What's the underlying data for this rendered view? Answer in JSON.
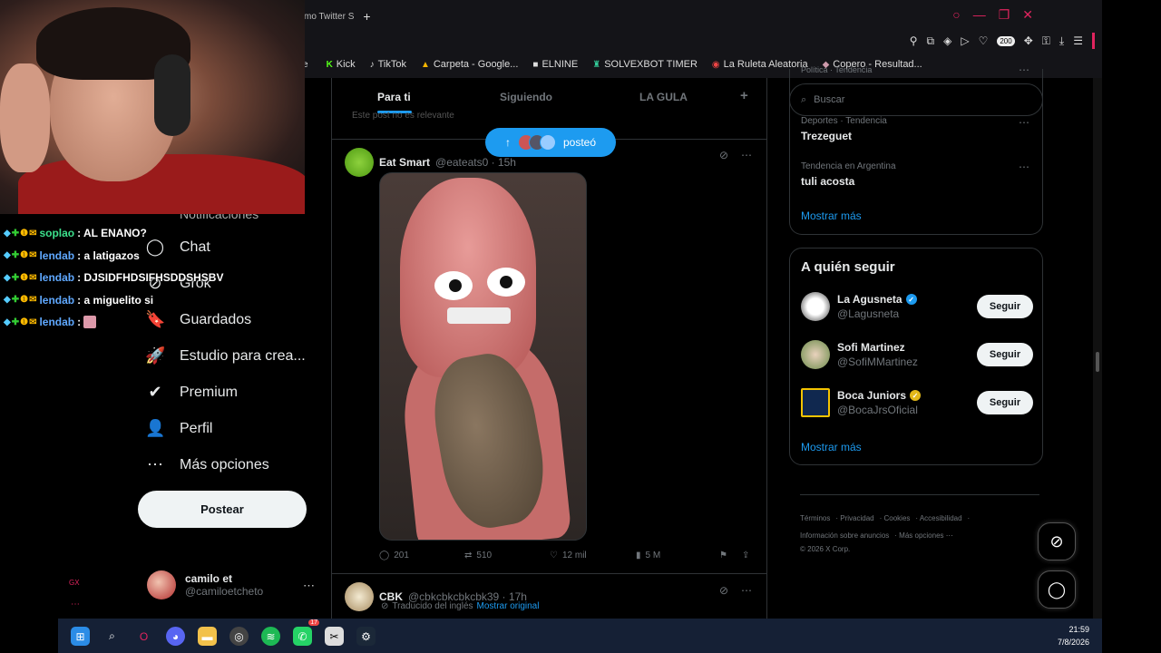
{
  "browser": {
    "tab_title": "itmo Twitter S",
    "new_tab": "+",
    "window_controls": [
      "○",
      "—",
      "❐",
      "✕"
    ],
    "extension_badge": "200",
    "bookmarks": [
      {
        "icon": "e",
        "label": ""
      },
      {
        "icon": "K",
        "label": "Kick"
      },
      {
        "icon": "♪",
        "label": "TikTok"
      },
      {
        "icon": "▲",
        "label": "Carpeta - Google..."
      },
      {
        "icon": "■",
        "label": "ELNINE"
      },
      {
        "icon": "♜",
        "label": "SOLVEXBOT TIMER"
      },
      {
        "icon": "◉",
        "label": "La Ruleta Aleatoria"
      },
      {
        "icon": "◆",
        "label": "Copero - Resultad..."
      }
    ]
  },
  "nav": {
    "partial_label": "Notificaciones",
    "items": [
      {
        "icon": "◯",
        "label": "Chat"
      },
      {
        "icon": "⊘",
        "label": "Grok"
      },
      {
        "icon": "🔖",
        "label": "Guardados"
      },
      {
        "icon": "🚀",
        "label": "Estudio para crea..."
      },
      {
        "icon": "✔",
        "label": "Premium"
      },
      {
        "icon": "👤",
        "label": "Perfil"
      },
      {
        "icon": "⋯",
        "label": "Más opciones"
      }
    ],
    "post_button": "Postear",
    "account": {
      "name": "camilo et",
      "handle": "@camiloetcheto",
      "more": "⋯"
    },
    "gx": "GX",
    "gx_dots": "⋯"
  },
  "stream_chat": [
    {
      "user": "soplao",
      "color": "green",
      "message": ": AL ENANO?"
    },
    {
      "user": "lendab",
      "color": "blue",
      "message": ": a latigazos"
    },
    {
      "user": "lendab",
      "color": "blue",
      "message": ": DJSIDFHDSIFHSDDSHSBV"
    },
    {
      "user": "lendab",
      "color": "blue",
      "message": ": a miguelito si"
    },
    {
      "user": "lendab",
      "color": "blue",
      "message": ":"
    }
  ],
  "timeline": {
    "tabs": [
      "Para ti",
      "Siguiendo",
      "LA GULA"
    ],
    "add_tab": "+",
    "hidden_note": "Este post no es relevante",
    "new_posts_label": "posteó",
    "tweet1": {
      "display_name": "Eat Smart",
      "handle": "@eateats0 · 15h",
      "replies": "201",
      "reposts": "510",
      "likes": "12 mil",
      "views": "5 M"
    },
    "tweet2": {
      "display_name": "CBK",
      "handle": "@cbkcbkcbkcbk39 · 17h",
      "translated": "Traducido del inglés",
      "show_original": "Mostrar original"
    }
  },
  "sidebar": {
    "search_placeholder": "Buscar",
    "trends": [
      {
        "category": "Deportes · Tendencia",
        "name": "Trezeguet"
      },
      {
        "category": "Tendencia en Argentina",
        "name": "tuli acosta"
      }
    ],
    "top_partial": "Política · Tendencia",
    "show_more": "Mostrar más",
    "follow_title": "A quién seguir",
    "suggestions": [
      {
        "name": "La Agusneta",
        "handle": "@Lagusneta",
        "badge_color": "#1d9bf0",
        "button": "Seguir"
      },
      {
        "name": "Sofi Martinez",
        "handle": "@SofiMMartinez",
        "badge_color": "",
        "button": "Seguir"
      },
      {
        "name": "Boca Juniors",
        "handle": "@BocaJrsOficial",
        "badge_color": "#e2b719",
        "button": "Seguir"
      }
    ],
    "footer_line1": [
      "Términos",
      "Privacidad",
      "Cookies",
      "Accesibilidad"
    ],
    "footer_line2": [
      "Información sobre anuncios",
      "Más opciones ⋯"
    ],
    "copyright": "© 2026 X Corp."
  },
  "taskbar": {
    "time": "21:59",
    "date": "7/8/2026",
    "whatsapp_badge": "17"
  },
  "colors": {
    "accent": "#1d9bf0",
    "opera_red": "#e0245e",
    "taskbar": "#152035"
  }
}
